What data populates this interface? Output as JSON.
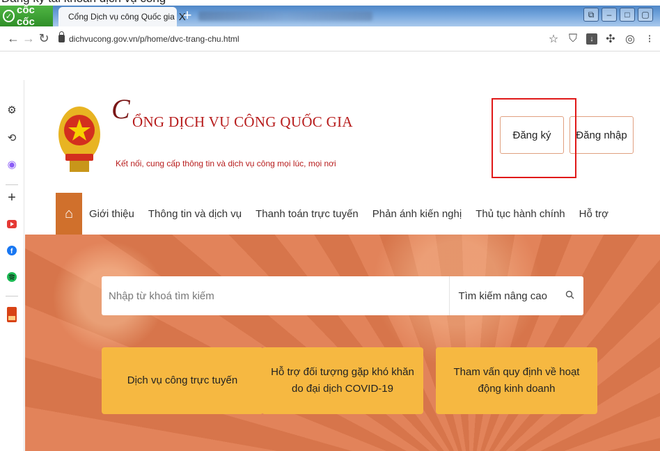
{
  "top_text": "Đăng ký tài khoản dịch vụ công",
  "browser": {
    "name": "cốc cốc",
    "tab_title": "Cổng Dịch vụ công Quốc gia",
    "tab_close": "X",
    "new_tab": "+",
    "url": "dichvucong.gov.vn/p/home/dvc-trang-chu.html"
  },
  "site": {
    "title": "ỔNG DỊCH VỤ CÔNG QUỐC GIA",
    "title_initial": "C",
    "subtitle": "Kết nối, cung cấp thông tin và dịch vụ công mọi lúc, mọi nơi",
    "register_label": "Đăng ký",
    "login_label": "Đăng nhập"
  },
  "menu": {
    "items": [
      "Giới thiệu",
      "Thông tin và dịch vụ",
      "Thanh toán trực tuyến",
      "Phản ánh kiến nghị",
      "Thủ tục hành chính",
      "Hỗ trợ"
    ]
  },
  "search": {
    "placeholder": "Nhập từ khoá tìm kiếm",
    "advanced_label": "Tìm kiếm nâng cao"
  },
  "cards": [
    "Dịch vụ công trực tuyến",
    "Hỗ trợ đối tượng gặp khó khăn do đại dịch COVID-19",
    "Tham vấn quy định về hoạt động kinh doanh"
  ],
  "colors": {
    "hero": "#e07a4e",
    "card": "#f6b841",
    "brand_red": "#b71c1c",
    "highlight": "#e01818",
    "home_tab": "#d0702c"
  }
}
